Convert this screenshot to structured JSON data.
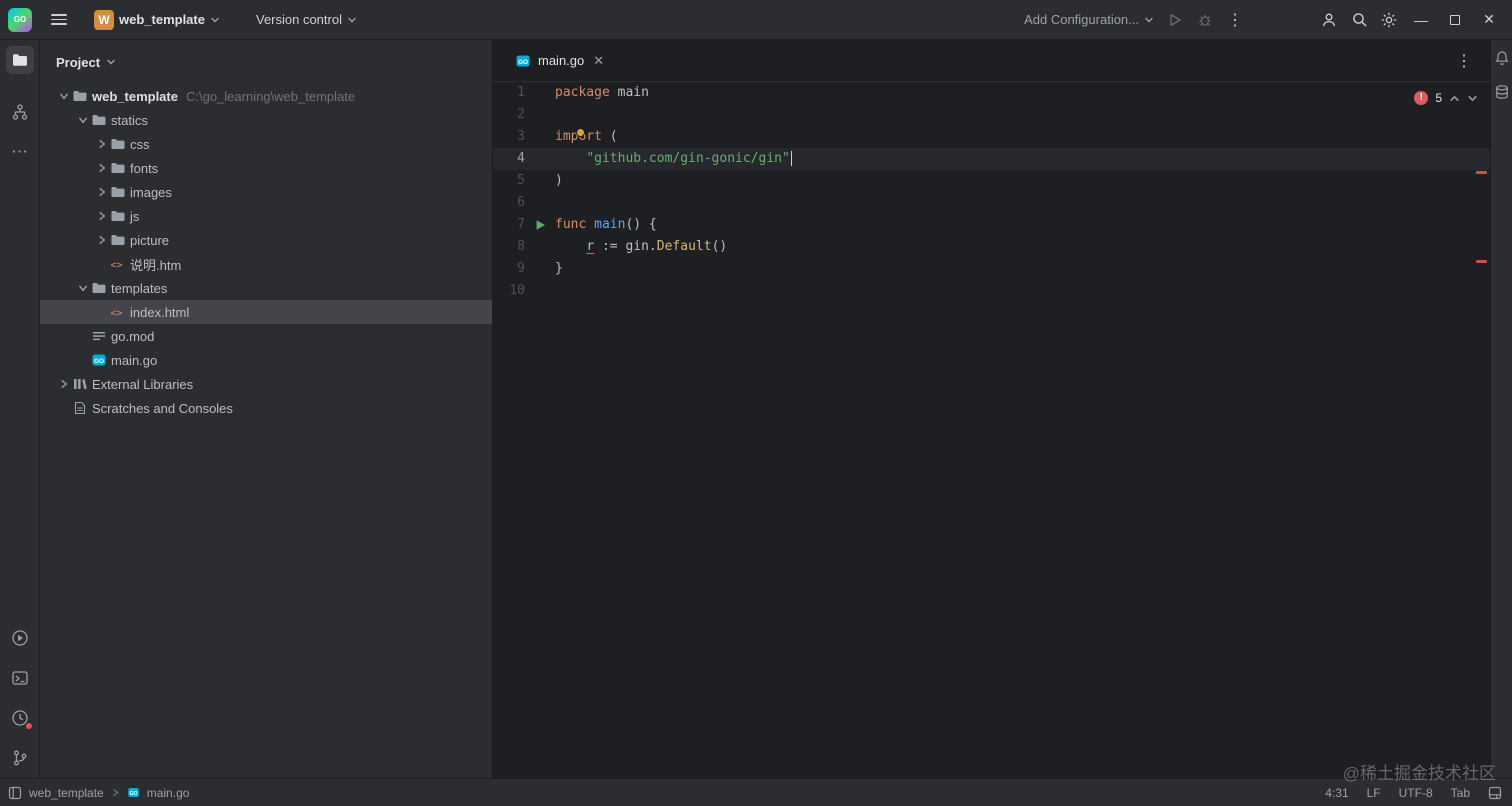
{
  "titlebar": {
    "logo_text": "GO",
    "project_widget": {
      "badge": "W",
      "name": "web_template"
    },
    "version_control_label": "Version control",
    "run_config_label": "Add Configuration..."
  },
  "project_panel": {
    "header_label": "Project",
    "tree": [
      {
        "label": "web_template",
        "suffix": "C:\\go_learning\\web_template",
        "indent": 0,
        "chevron": "down",
        "icon": "folder",
        "bold": true
      },
      {
        "label": "statics",
        "indent": 1,
        "chevron": "down",
        "icon": "folder"
      },
      {
        "label": "css",
        "indent": 2,
        "chevron": "right",
        "icon": "folder"
      },
      {
        "label": "fonts",
        "indent": 2,
        "chevron": "right",
        "icon": "folder"
      },
      {
        "label": "images",
        "indent": 2,
        "chevron": "right",
        "icon": "folder"
      },
      {
        "label": "js",
        "indent": 2,
        "chevron": "right",
        "icon": "folder"
      },
      {
        "label": "picture",
        "indent": 2,
        "chevron": "right",
        "icon": "folder"
      },
      {
        "label": "说明.htm",
        "indent": 2,
        "chevron": "none",
        "icon": "html"
      },
      {
        "label": "templates",
        "indent": 1,
        "chevron": "down",
        "icon": "folder"
      },
      {
        "label": "index.html",
        "indent": 2,
        "chevron": "none",
        "icon": "html",
        "selected": true
      },
      {
        "label": "go.mod",
        "indent": 1,
        "chevron": "none",
        "icon": "gomod"
      },
      {
        "label": "main.go",
        "indent": 1,
        "chevron": "none",
        "icon": "gofile"
      },
      {
        "label": "External Libraries",
        "indent": 0,
        "chevron": "right",
        "icon": "lib"
      },
      {
        "label": "Scratches and Consoles",
        "indent": 0,
        "chevron": "none",
        "icon": "scratch"
      }
    ]
  },
  "editor": {
    "tabs": [
      {
        "label": "main.go",
        "active": true
      }
    ],
    "inspection": {
      "error_icon": "error-circle",
      "error_count": "5"
    },
    "lines": [
      {
        "num": 1,
        "tokens": [
          {
            "t": "package",
            "c": "kw"
          },
          {
            "t": " main",
            "c": "plain"
          }
        ]
      },
      {
        "num": 2,
        "tokens": []
      },
      {
        "num": 3,
        "tokens": [
          {
            "t": "import",
            "c": "kw"
          },
          {
            "t": " (",
            "c": "plain"
          }
        ]
      },
      {
        "num": 4,
        "current": true,
        "caret": true,
        "tokens": [
          {
            "t": "    ",
            "c": "plain"
          },
          {
            "t": "\"github.com/gin-gonic/gin\"",
            "c": "str"
          }
        ]
      },
      {
        "num": 5,
        "tokens": [
          {
            "t": ")",
            "c": "plain"
          }
        ]
      },
      {
        "num": 6,
        "tokens": []
      },
      {
        "num": 7,
        "run": true,
        "tokens": [
          {
            "t": "func",
            "c": "kw"
          },
          {
            "t": " ",
            "c": "plain"
          },
          {
            "t": "main",
            "c": "fn"
          },
          {
            "t": "() {",
            "c": "plain"
          }
        ]
      },
      {
        "num": 8,
        "tokens": [
          {
            "t": "    ",
            "c": "plain"
          },
          {
            "t": "r",
            "c": "err"
          },
          {
            "t": " := gin.",
            "c": "plain"
          },
          {
            "t": "Default",
            "c": "call"
          },
          {
            "t": "()",
            "c": "plain"
          }
        ]
      },
      {
        "num": 9,
        "tokens": [
          {
            "t": "}",
            "c": "plain"
          }
        ]
      },
      {
        "num": 10,
        "tokens": []
      }
    ]
  },
  "status_bar": {
    "breadcrumbs": [
      "web_template",
      "main.go"
    ],
    "cursor_position": "4:31",
    "line_separator": "LF",
    "encoding": "UTF-8",
    "indent": "Tab"
  },
  "watermark": "@稀土掘金技术社区",
  "colors": {
    "panel_bg": "#2b2d30",
    "editor_bg": "#1e1f22",
    "selection": "#43454a",
    "current_line": "#26282e",
    "keyword": "#cf8e6d",
    "string": "#6aab73",
    "function_decl": "#56a8f5",
    "function_call": "#d5b778",
    "error_red": "#f75464",
    "run_green": "#5fad65",
    "go_icon_blue": "#00add8"
  },
  "icons": {
    "titlebar": [
      "goland-logo",
      "menu-icon",
      "chevron-down-icon",
      "run-icon",
      "debug-icon",
      "kebab-menu-icon",
      "user-icon",
      "search-icon",
      "gear-icon",
      "minimize-icon",
      "maximize-icon",
      "close-icon"
    ],
    "left_stripe": [
      "folder-icon",
      "structure-icon",
      "more-icon",
      "run-circle-icon",
      "terminal-icon",
      "clock-icon",
      "git-branch-icon"
    ],
    "right_stripe": [
      "bell-icon",
      "database-icon"
    ],
    "status_bar": [
      "tool-windows-icon",
      "go-file-icon",
      "window-layout-icon"
    ]
  }
}
